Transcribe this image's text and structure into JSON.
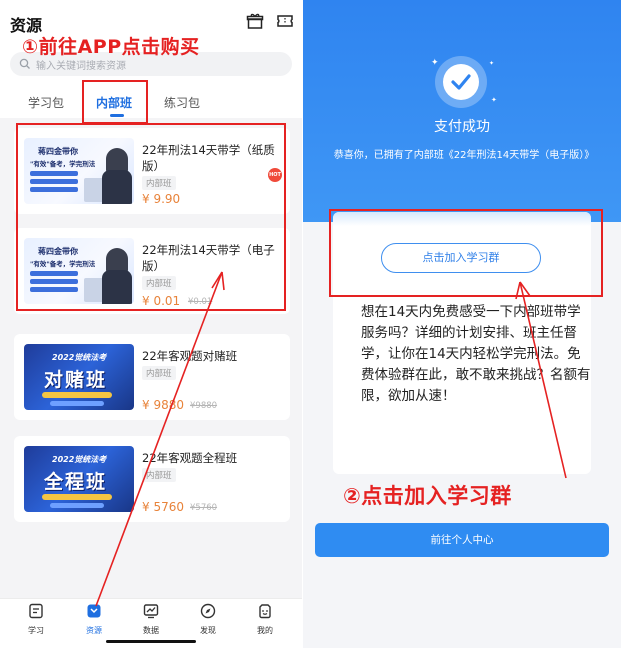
{
  "left": {
    "header": {
      "title": "资源"
    },
    "search": {
      "placeholder": "输入关键词搜索资源"
    },
    "tabs": [
      {
        "label": "学习包"
      },
      {
        "label": "内部班",
        "active": true
      },
      {
        "label": "练习包"
      }
    ],
    "callout": "①前往APP点击购买",
    "products": [
      {
        "title": "22年刑法14天带学（纸质版）",
        "tag": "内部班",
        "price": "¥ 9.90",
        "old_price": "",
        "hot": "HOT",
        "thumb": {
          "line1": "蒋四金带你",
          "line2": "\"有效\"备考，学完刑法"
        }
      },
      {
        "title": "22年刑法14天带学（电子版）",
        "tag": "内部班",
        "price": "¥ 0.01",
        "old_price": "¥0.01",
        "thumb": {
          "line1": "蒋四金带你",
          "line2": "\"有效\"备考，学完刑法"
        }
      },
      {
        "title": "22年客观题对赌班",
        "tag": "内部班",
        "price": "¥ 9880",
        "old_price": "¥9880",
        "thumb": {
          "line1": "2022觉统法考",
          "line2": "对赌班"
        }
      },
      {
        "title": "22年客观题全程班",
        "tag": "内部班",
        "price": "¥ 5760",
        "old_price": "¥5760",
        "thumb": {
          "line1": "2022觉统法考",
          "line2": "全程班"
        }
      }
    ],
    "tabbar": [
      {
        "label": "学习",
        "icon": "book-icon"
      },
      {
        "label": "资源",
        "icon": "resource-icon",
        "active": true
      },
      {
        "label": "数据",
        "icon": "chart-icon"
      },
      {
        "label": "发现",
        "icon": "compass-icon"
      },
      {
        "label": "我的",
        "icon": "profile-icon"
      }
    ]
  },
  "right": {
    "pay_title": "支付成功",
    "pay_desc": "恭喜你，已拥有了内部班《22年刑法14天带学（电子版）》",
    "join_button": "点击加入学习群",
    "panel_text": "想在14天内免费感受一下内部班带学服务吗？详细的计划安排、班主任督学，让你在14天内轻松学完刑法。免费体验群在此，敢不敢来挑战？名额有限，欲加从速！",
    "callout": "②点击加入学习群",
    "go_button": "前往个人中心"
  },
  "colors": {
    "accent": "#1f6fe0",
    "price": "#e8833a",
    "annotation": "#e52222",
    "success_bg": "#2f84f0"
  }
}
